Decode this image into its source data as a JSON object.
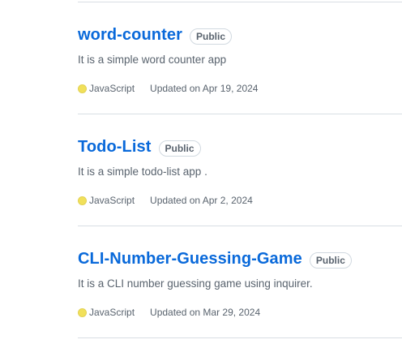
{
  "colors": {
    "link": "#0969da",
    "muted": "#59636e",
    "divider": "#d8dee4",
    "javascript": "#f1e05a"
  },
  "repos": [
    {
      "name": "word-counter",
      "visibility": "Public",
      "description": "It is a simple word counter app",
      "language": "JavaScript",
      "language_color": "#f1e05a",
      "updated": "Updated on Apr 19, 2024"
    },
    {
      "name": "Todo-List",
      "visibility": "Public",
      "description": "It is a simple todo-list app .",
      "language": "JavaScript",
      "language_color": "#f1e05a",
      "updated": "Updated on Apr 2, 2024"
    },
    {
      "name": "CLI-Number-Guessing-Game",
      "visibility": "Public",
      "description": "It is a CLI number guessing game using inquirer.",
      "language": "JavaScript",
      "language_color": "#f1e05a",
      "updated": "Updated on Mar 29, 2024"
    }
  ]
}
